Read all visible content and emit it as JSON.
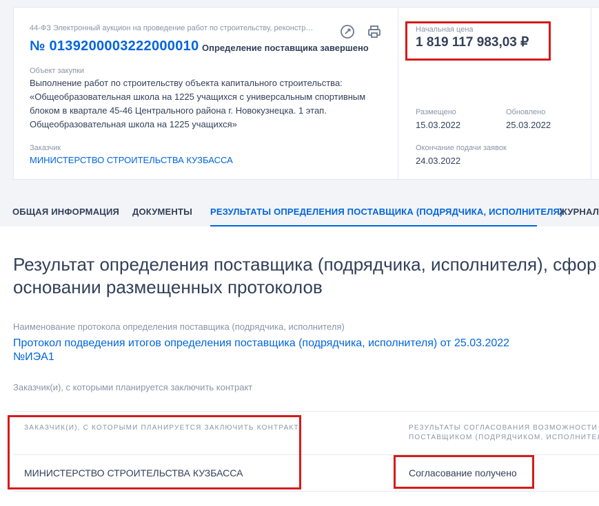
{
  "purchase": {
    "law_line": "44-ФЗ Электронный аукцион на проведение работ по строительству, реконструкц...",
    "number": "№ 0139200003222000010",
    "status": "Определение поставщика завершено",
    "object_label": "Объект закупки",
    "object_text": "Выполнение работ по строительству объекта капитального строительства: «Общеобразовательная школа на 1225 учащихся с универсальным спортивным блоком в квартале 45-46 Центрального района г. Новокузнецка. 1 этап. Общеобразовательная школа на 1225 учащихся»",
    "customer_label": "Заказчик",
    "customer": "МИНИСТЕРСТВО СТРОИТЕЛЬСТВА КУЗБАССА",
    "price_label": "Начальная цена",
    "price": "1 819 117 983,03 ₽",
    "posted_label": "Размещено",
    "posted": "15.03.2022",
    "updated_label": "Обновлено",
    "updated": "25.03.2022",
    "deadline_label": "Окончание подачи заявок",
    "deadline": "24.03.2022"
  },
  "tabs": [
    {
      "label": "ОБЩАЯ ИНФОРМАЦИЯ"
    },
    {
      "label": "ДОКУМЕНТЫ"
    },
    {
      "label": "РЕЗУЛЬТАТЫ ОПРЕДЕЛЕНИЯ ПОСТАВЩИКА (ПОДРЯДЧИКА, ИСПОЛНИТЕЛЯ)"
    },
    {
      "label": "ЖУРНАЛ"
    }
  ],
  "result": {
    "title_line1": "Результат определения поставщика (подрядчика, исполнителя), сфор",
    "title_line2": "основании размещенных протоколов",
    "protocol_label": "Наименование протокола определения поставщика (подрядчика, исполнителя)",
    "protocol_link": "Протокол подведения итогов определения поставщика (подрядчика, исполнителя) от 25.03.2022 №ИЭА1",
    "customers_label": "Заказчик(и), с которыми планируется заключить контракт"
  },
  "table": {
    "col1_header": "ЗАКАЗЧИК(И), С КОТОРЫМИ ПЛАНИРУЕТСЯ ЗАКЛЮЧИТЬ КОНТРАКТ",
    "col2_header_line1": "РЕЗУЛЬТАТЫ СОГЛАСОВАНИЯ ВОЗМОЖНОСТИ ЗА",
    "col2_header_line2": "ПОСТАВЩИКОМ (ПОДРЯДЧИКОМ, ИСПОЛНИТЕЛЕ",
    "rows": [
      {
        "customer": "МИНИСТЕРСТВО СТРОИТЕЛЬСТВА КУЗБАССА",
        "approval": "Согласование получено"
      }
    ]
  },
  "colors": {
    "accent": "#0065dd",
    "highlight": "#d61a1a",
    "text": "#334059",
    "muted": "#8a94a8"
  },
  "icons": [
    "link-icon",
    "print-icon"
  ]
}
